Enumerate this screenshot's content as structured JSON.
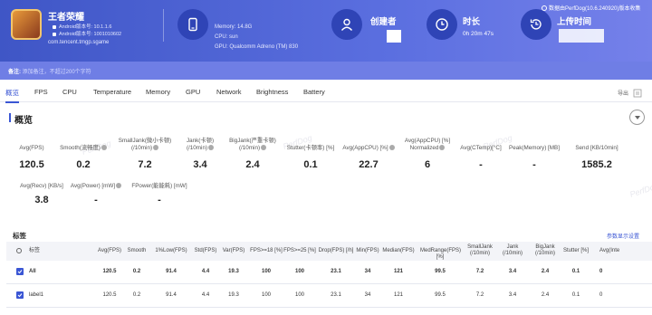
{
  "header": {
    "app_name": "王者荣耀",
    "android_version": "Android版本号: 10.1.1.6",
    "android_build": "Android版本号: 1001010602",
    "package": "com.tencent.tmgp.sgame",
    "memory": "Memory: 14.8G",
    "cpu": "CPU: sun",
    "gpu": "GPU: Qualcomm Adreno (TM) 830",
    "creator_label": "创建者",
    "duration_label": "时长",
    "duration_value": "0h 20m 47s",
    "upload_label": "上传时间",
    "source": "数据由PerfDog(10.6.240920)版本收集",
    "note_label": "备注:",
    "note_placeholder": "添加备注，不超过200个字符",
    "icons": [
      "phone-icon",
      "user-icon",
      "clock-icon",
      "history-icon"
    ]
  },
  "tabs": [
    "概览",
    "FPS",
    "CPU",
    "Temperature",
    "Memory",
    "GPU",
    "Network",
    "Brightness",
    "Battery"
  ],
  "export_label": "导出",
  "overview": {
    "title": "概览",
    "watermark": "PerfDog",
    "metrics_row1": [
      {
        "label": "Avg(FPS)",
        "value": "120.5",
        "help": false
      },
      {
        "label": "Smooth(流畅度)",
        "value": "0.2",
        "help": true
      },
      {
        "label": "SmallJank(微小卡顿)\n(/10min)",
        "value": "7.2",
        "help": true
      },
      {
        "label": "Jank(卡顿)\n(/10min)",
        "value": "3.4",
        "help": true
      },
      {
        "label": "BigJank(严重卡顿)\n(/10min)",
        "value": "2.4",
        "help": true
      },
      {
        "label": "Stutter(卡顿率) [%]",
        "value": "0.1",
        "help": false
      },
      {
        "label": "Avg(AppCPU) [%]",
        "value": "22.7",
        "help": true
      },
      {
        "label": "Avg(AppCPU) [%]\nNormalized",
        "value": "6",
        "help": true
      },
      {
        "label": "Avg(CTemp)[°C]",
        "value": "-",
        "help": false
      },
      {
        "label": "Peak(Memory) [MB]",
        "value": "-",
        "help": false
      },
      {
        "label": "Send [KB/10min]",
        "value": "1585.2",
        "help": false
      }
    ],
    "metrics_row2": [
      {
        "label": "Avg(Recv) [KB/s]",
        "value": "3.8",
        "help": false
      },
      {
        "label": "Avg(Power) [mW]",
        "value": "-",
        "help": true
      },
      {
        "label": "FPower(能能耗) [mW]",
        "value": "-",
        "help": false
      }
    ]
  },
  "labels": {
    "title": "标签",
    "settings_link": "参数显示设置",
    "columns": [
      "标签",
      "Avg(FPS)",
      "Smooth",
      "1%Low(FPS)",
      "Std(FPS)",
      "Var(FPS)",
      "FPS>=18 [%]",
      "FPS>=25 [%]",
      "Drop(FPS) [/h]",
      "Min(FPS)",
      "Median(FPS)",
      "MedRange(FPS)[%]",
      "SmallJank\n(/10min)",
      "Jank\n(/10min)",
      "BigJank\n(/10min)",
      "Stutter [%]",
      "Avg(Inte"
    ],
    "rows": [
      {
        "name": "All",
        "values": [
          "120.5",
          "0.2",
          "91.4",
          "4.4",
          "19.3",
          "100",
          "100",
          "23.1",
          "34",
          "121",
          "99.5",
          "7.2",
          "3.4",
          "2.4",
          "0.1",
          "0"
        ]
      },
      {
        "name": "label1",
        "values": [
          "120.5",
          "0.2",
          "91.4",
          "4.4",
          "19.3",
          "100",
          "100",
          "23.1",
          "34",
          "121",
          "99.5",
          "7.2",
          "3.4",
          "2.4",
          "0.1",
          "0"
        ]
      }
    ]
  }
}
